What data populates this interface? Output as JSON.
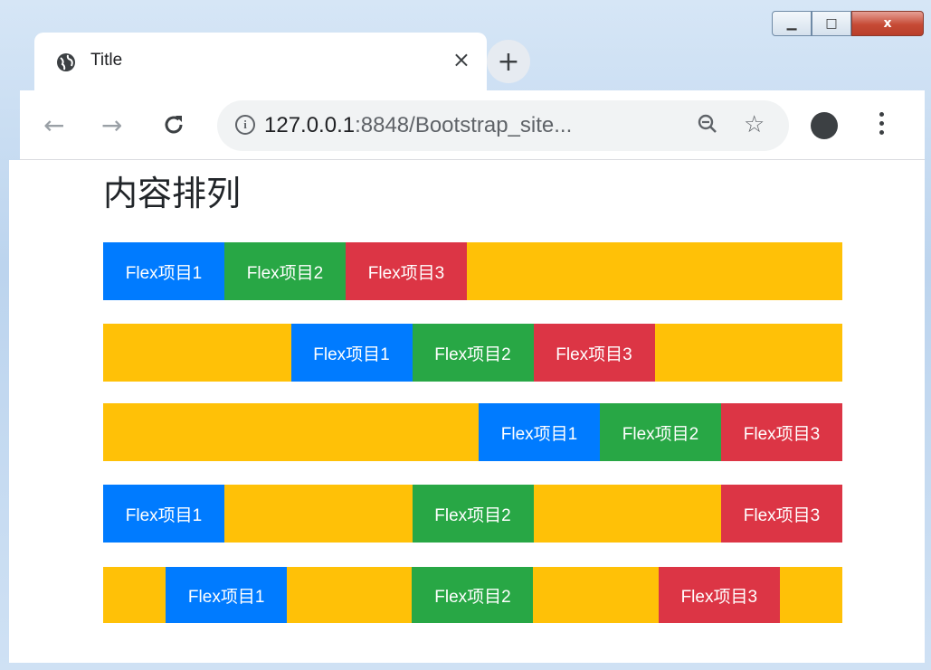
{
  "browser": {
    "tab_title": "Title",
    "tab_close": "×",
    "new_tab": "+",
    "url_host": "127.0.0.1",
    "url_rest": ":8848/Bootstrap_site...",
    "controls": {
      "minimize": "▁",
      "maximize": "□",
      "close": "x"
    }
  },
  "page": {
    "heading": "内容排列",
    "rows": [
      {
        "items": [
          "Flex项目1",
          "Flex项目2",
          "Flex项目3"
        ]
      },
      {
        "items": [
          "Flex项目1",
          "Flex项目2",
          "Flex项目3"
        ]
      },
      {
        "items": [
          "Flex项目1",
          "Flex项目2",
          "Flex项目3"
        ]
      },
      {
        "items": [
          "Flex项目1",
          "Flex项目2",
          "Flex项目3"
        ]
      },
      {
        "items": [
          "Flex项目1",
          "Flex项目2",
          "Flex项目3"
        ]
      }
    ]
  },
  "colors": {
    "row_bg": "#ffc107",
    "blue": "#007bff",
    "green": "#28a745",
    "red": "#dc3545"
  },
  "icons": [
    "globe-icon",
    "close-icon",
    "plus-icon",
    "back-arrow-icon",
    "forward-arrow-icon",
    "reload-icon",
    "info-icon",
    "zoom-out-icon",
    "star-icon",
    "account-icon",
    "menu-dots-icon"
  ]
}
